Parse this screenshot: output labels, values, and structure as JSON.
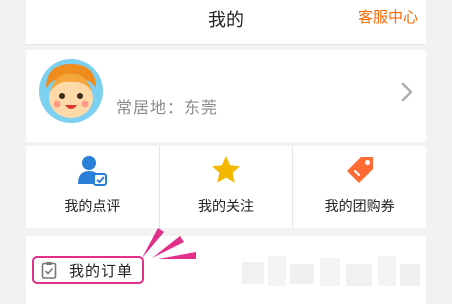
{
  "header": {
    "title": "我的",
    "service_link": "客服中心"
  },
  "profile": {
    "location": "常居地：东莞"
  },
  "quick_actions": [
    {
      "label": "我的点评",
      "icon": "user-review-icon"
    },
    {
      "label": "我的关注",
      "icon": "star-icon"
    },
    {
      "label": "我的团购券",
      "icon": "coupon-tag-icon"
    }
  ],
  "orders": {
    "label": "我的订单",
    "icon": "clipboard-check-icon"
  },
  "colors": {
    "accent": "#ff6600",
    "highlight": "#e2308a",
    "icon_blue": "#2a7fd6",
    "icon_yellow": "#f5b800",
    "icon_orange": "#ff6b33"
  }
}
